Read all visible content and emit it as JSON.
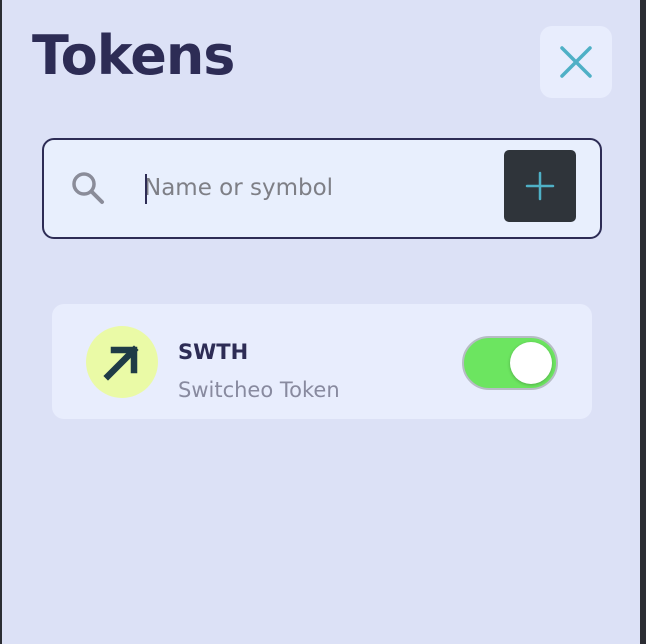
{
  "panel": {
    "title": "Tokens"
  },
  "search": {
    "placeholder": "Name or symbol",
    "value": ""
  },
  "icons": {
    "close": "close-icon",
    "search": "search-icon",
    "add": "plus-icon",
    "token_logo": "switcheo-arrow-icon"
  },
  "tokens": [
    {
      "symbol": "SWTH",
      "name": "Switcheo Token",
      "enabled": true
    }
  ],
  "colors": {
    "panel_bg": "#dce1f6",
    "title": "#2d2c55",
    "close_icon": "#4fb0c6",
    "add_button_bg": "#2f343a",
    "add_icon": "#4fb0c6",
    "toggle_on": "#6ce560",
    "token_logo_bg": "#eafaa6"
  }
}
